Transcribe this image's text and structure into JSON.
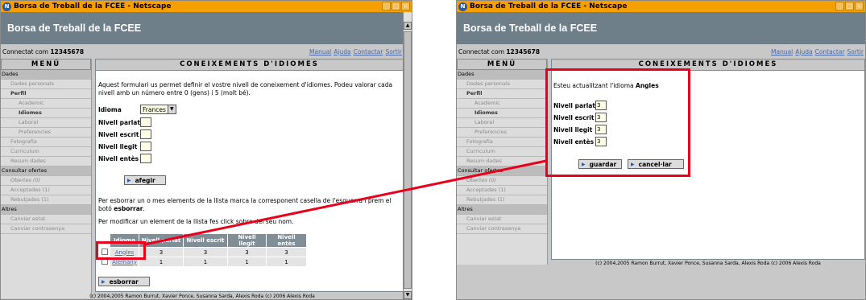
{
  "window_title": "Borsa de Treball de la FCEE - Netscape",
  "app_title": "Borsa de Treball de la FCEE",
  "connected_label": "Connectat com",
  "user_id": "12345678",
  "links": [
    "Manual",
    "Ajuda",
    "Contactar",
    "Sortir"
  ],
  "menu": {
    "title": "MENÚ",
    "dades": "Dades",
    "dades_personals": "Dades personals",
    "perfil": "Perfil",
    "academic": "Academic",
    "idiomes": "Idiomes",
    "laboral": "Laboral",
    "preferencies": "Preferencies",
    "fotografia": "Fotografia",
    "curriculum": "Curriculum",
    "resum_dades": "Resum dades",
    "consultar_ofertes": "Consultar ofertes",
    "obertes": "Obertes (0)",
    "acceptades": "Acceptades (1)",
    "rebutjades": "Rebutjades (1)",
    "altres": "Altres",
    "canviar_estat": "Canviar estat",
    "canviar_contrasenya": "Canviar contrasenya"
  },
  "section_title": "CONEIXEMENTS D'IDIOMES",
  "left": {
    "intro": "Aquest formulari us permet definir el vostre nivell de coneixement d'idiomes. Podeu valorar cada nivell amb un número entre 0 (gens) i 5 (molt bé).",
    "idioma_label": "Idioma",
    "idioma_value": "Frances",
    "nivell_parlat": "Nivell parlat",
    "nivell_escrit": "Nivell escrit",
    "nivell_llegit": "Nivell llegit",
    "nivell_entes": "Nivell entès",
    "afegir": "afegir",
    "delete_text_1": "Per esborrar un o mes elements de la llista marca la corresponent casella de l'esquerra i prem el",
    "delete_text_2": "botó",
    "delete_text_bold": "esborrar",
    "modify_text": "Per modificar un element de la llista fes click sobre del seu nom.",
    "table_headers": [
      "Idioma",
      "Nivell parlat",
      "Nivell escrit",
      "Nivell llegit",
      "Nivell entès"
    ],
    "rows": [
      {
        "name": "Angles",
        "parlat": "3",
        "escrit": "3",
        "llegit": "3",
        "entes": "3"
      },
      {
        "name": "Alemany",
        "parlat": "1",
        "escrit": "1",
        "llegit": "1",
        "entes": "1"
      }
    ],
    "esborrar": "esborrar",
    "footer": "(c) 2004,2005 Ramon Burrut, Xavier Ponce, Susanna Sarda, Alexis Roda (c) 2006 Alexis Roda"
  },
  "right": {
    "updating_text": "Esteu actualitzant l'idioma",
    "updating_lang": "Angles",
    "nivell_parlat": "Nivell parlat",
    "nivell_escrit": "Nivell escrit",
    "nivell_llegit": "Nivell llegit",
    "nivell_entes": "Nivell entès",
    "values": [
      "3",
      "3",
      "3",
      "3"
    ],
    "guardar": "guardar",
    "cancelar": "cancel·lar",
    "footer": "(c) 2004,2005 Ramon Burrut, Xavier Ponce, Susanna Sarda, Alexis Roda (c) 2006 Alexis Roda"
  },
  "colors": {
    "titlebar": "#f5a000",
    "header": "#6e7f8a",
    "highlight": "#e8001c",
    "link": "#4a6aa8"
  }
}
